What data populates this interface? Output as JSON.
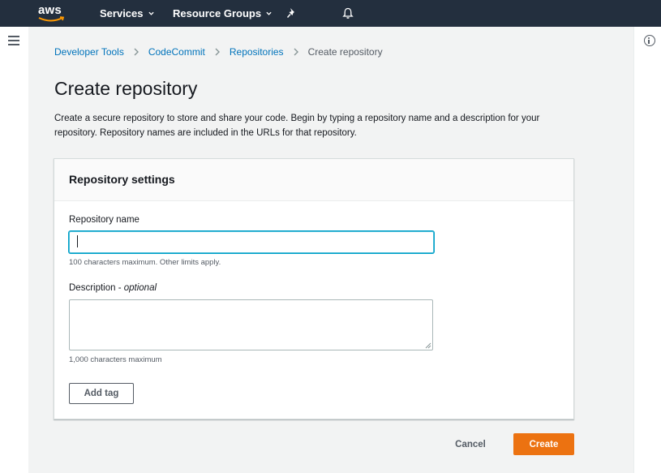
{
  "topnav": {
    "logo_text": "aws",
    "services_label": "Services",
    "resource_groups_label": "Resource Groups",
    "colors": {
      "background": "#232f3e",
      "logo_smile": "#ff9900"
    }
  },
  "breadcrumb": {
    "items": [
      "Developer Tools",
      "CodeCommit",
      "Repositories"
    ],
    "current": "Create repository"
  },
  "page": {
    "title": "Create repository",
    "description": "Create a secure repository to store and share your code. Begin by typing a repository name and a description for your repository. Repository names are included in the URLs for that repository."
  },
  "settings_panel": {
    "title": "Repository settings",
    "name_label": "Repository name",
    "name_value": "",
    "name_hint": "100 characters maximum. Other limits apply.",
    "description_label": "Description - ",
    "description_optional": "optional",
    "description_value": "",
    "description_hint": "1,000 characters maximum",
    "add_tag_label": "Add tag"
  },
  "actions": {
    "cancel_label": "Cancel",
    "create_label": "Create",
    "create_color": "#ec7211"
  },
  "icons": [
    "hamburger-icon",
    "chevron-down-icon",
    "pin-icon",
    "bell-icon",
    "info-icon",
    "chevron-right-icon"
  ]
}
